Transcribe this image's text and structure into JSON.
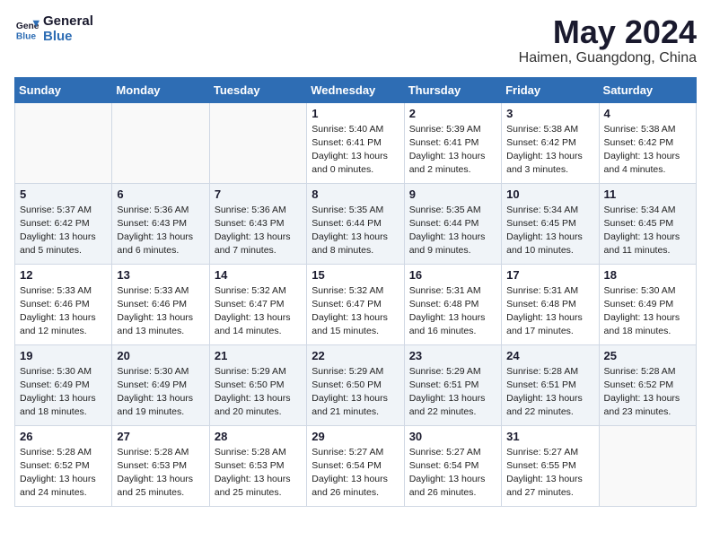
{
  "header": {
    "logo_line1": "General",
    "logo_line2": "Blue",
    "title": "May 2024",
    "subtitle": "Haimen, Guangdong, China"
  },
  "days_of_week": [
    "Sunday",
    "Monday",
    "Tuesday",
    "Wednesday",
    "Thursday",
    "Friday",
    "Saturday"
  ],
  "weeks": [
    [
      {
        "num": "",
        "info": ""
      },
      {
        "num": "",
        "info": ""
      },
      {
        "num": "",
        "info": ""
      },
      {
        "num": "1",
        "info": "Sunrise: 5:40 AM\nSunset: 6:41 PM\nDaylight: 13 hours\nand 0 minutes."
      },
      {
        "num": "2",
        "info": "Sunrise: 5:39 AM\nSunset: 6:41 PM\nDaylight: 13 hours\nand 2 minutes."
      },
      {
        "num": "3",
        "info": "Sunrise: 5:38 AM\nSunset: 6:42 PM\nDaylight: 13 hours\nand 3 minutes."
      },
      {
        "num": "4",
        "info": "Sunrise: 5:38 AM\nSunset: 6:42 PM\nDaylight: 13 hours\nand 4 minutes."
      }
    ],
    [
      {
        "num": "5",
        "info": "Sunrise: 5:37 AM\nSunset: 6:42 PM\nDaylight: 13 hours\nand 5 minutes."
      },
      {
        "num": "6",
        "info": "Sunrise: 5:36 AM\nSunset: 6:43 PM\nDaylight: 13 hours\nand 6 minutes."
      },
      {
        "num": "7",
        "info": "Sunrise: 5:36 AM\nSunset: 6:43 PM\nDaylight: 13 hours\nand 7 minutes."
      },
      {
        "num": "8",
        "info": "Sunrise: 5:35 AM\nSunset: 6:44 PM\nDaylight: 13 hours\nand 8 minutes."
      },
      {
        "num": "9",
        "info": "Sunrise: 5:35 AM\nSunset: 6:44 PM\nDaylight: 13 hours\nand 9 minutes."
      },
      {
        "num": "10",
        "info": "Sunrise: 5:34 AM\nSunset: 6:45 PM\nDaylight: 13 hours\nand 10 minutes."
      },
      {
        "num": "11",
        "info": "Sunrise: 5:34 AM\nSunset: 6:45 PM\nDaylight: 13 hours\nand 11 minutes."
      }
    ],
    [
      {
        "num": "12",
        "info": "Sunrise: 5:33 AM\nSunset: 6:46 PM\nDaylight: 13 hours\nand 12 minutes."
      },
      {
        "num": "13",
        "info": "Sunrise: 5:33 AM\nSunset: 6:46 PM\nDaylight: 13 hours\nand 13 minutes."
      },
      {
        "num": "14",
        "info": "Sunrise: 5:32 AM\nSunset: 6:47 PM\nDaylight: 13 hours\nand 14 minutes."
      },
      {
        "num": "15",
        "info": "Sunrise: 5:32 AM\nSunset: 6:47 PM\nDaylight: 13 hours\nand 15 minutes."
      },
      {
        "num": "16",
        "info": "Sunrise: 5:31 AM\nSunset: 6:48 PM\nDaylight: 13 hours\nand 16 minutes."
      },
      {
        "num": "17",
        "info": "Sunrise: 5:31 AM\nSunset: 6:48 PM\nDaylight: 13 hours\nand 17 minutes."
      },
      {
        "num": "18",
        "info": "Sunrise: 5:30 AM\nSunset: 6:49 PM\nDaylight: 13 hours\nand 18 minutes."
      }
    ],
    [
      {
        "num": "19",
        "info": "Sunrise: 5:30 AM\nSunset: 6:49 PM\nDaylight: 13 hours\nand 18 minutes."
      },
      {
        "num": "20",
        "info": "Sunrise: 5:30 AM\nSunset: 6:49 PM\nDaylight: 13 hours\nand 19 minutes."
      },
      {
        "num": "21",
        "info": "Sunrise: 5:29 AM\nSunset: 6:50 PM\nDaylight: 13 hours\nand 20 minutes."
      },
      {
        "num": "22",
        "info": "Sunrise: 5:29 AM\nSunset: 6:50 PM\nDaylight: 13 hours\nand 21 minutes."
      },
      {
        "num": "23",
        "info": "Sunrise: 5:29 AM\nSunset: 6:51 PM\nDaylight: 13 hours\nand 22 minutes."
      },
      {
        "num": "24",
        "info": "Sunrise: 5:28 AM\nSunset: 6:51 PM\nDaylight: 13 hours\nand 22 minutes."
      },
      {
        "num": "25",
        "info": "Sunrise: 5:28 AM\nSunset: 6:52 PM\nDaylight: 13 hours\nand 23 minutes."
      }
    ],
    [
      {
        "num": "26",
        "info": "Sunrise: 5:28 AM\nSunset: 6:52 PM\nDaylight: 13 hours\nand 24 minutes."
      },
      {
        "num": "27",
        "info": "Sunrise: 5:28 AM\nSunset: 6:53 PM\nDaylight: 13 hours\nand 25 minutes."
      },
      {
        "num": "28",
        "info": "Sunrise: 5:28 AM\nSunset: 6:53 PM\nDaylight: 13 hours\nand 25 minutes."
      },
      {
        "num": "29",
        "info": "Sunrise: 5:27 AM\nSunset: 6:54 PM\nDaylight: 13 hours\nand 26 minutes."
      },
      {
        "num": "30",
        "info": "Sunrise: 5:27 AM\nSunset: 6:54 PM\nDaylight: 13 hours\nand 26 minutes."
      },
      {
        "num": "31",
        "info": "Sunrise: 5:27 AM\nSunset: 6:55 PM\nDaylight: 13 hours\nand 27 minutes."
      },
      {
        "num": "",
        "info": ""
      }
    ]
  ]
}
